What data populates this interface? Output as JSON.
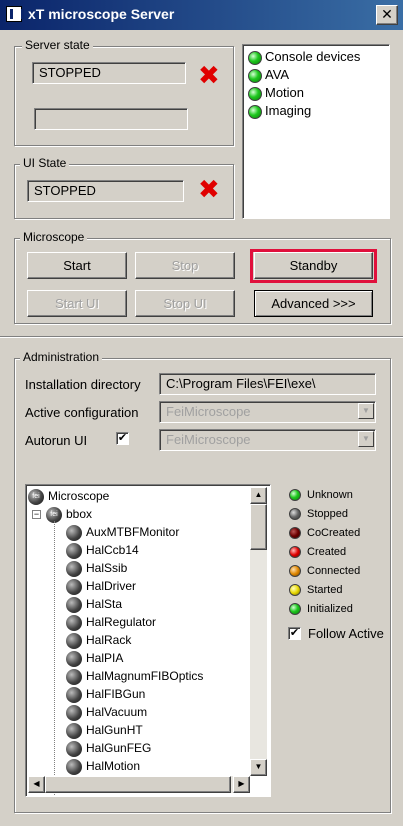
{
  "window": {
    "title": "xT microscope Server",
    "close": "✕"
  },
  "server_state": {
    "legend": "Server state",
    "value": "STOPPED",
    "secondary": "",
    "icon": "red-x-icon"
  },
  "ui_state": {
    "legend": "UI State",
    "value": "STOPPED",
    "icon": "red-x-icon"
  },
  "status_list": [
    {
      "label": "Console devices",
      "color": "green"
    },
    {
      "label": "AVA",
      "color": "green"
    },
    {
      "label": "Motion",
      "color": "green"
    },
    {
      "label": "Imaging",
      "color": "green"
    }
  ],
  "microscope": {
    "legend": "Microscope",
    "start": "Start",
    "stop": "Stop",
    "standby": "Standby",
    "start_ui": "Start UI",
    "stop_ui": "Stop UI",
    "advanced": "Advanced >>>",
    "highlight_color": "#e0103c"
  },
  "administration": {
    "legend": "Administration",
    "install_label": "Installation directory",
    "install_value": "C:\\Program Files\\FEI\\exe\\",
    "active_config_label": "Active configuration",
    "active_config_value": "FeiMicroscope",
    "autorun_label": "Autorun UI",
    "autorun_checked": "✔",
    "autorun_value": "FeiMicroscope"
  },
  "tree": {
    "root": "Microscope",
    "bbox": "bbox",
    "root_badge": "fei",
    "children": [
      "AuxMTBFMonitor",
      "HalCcb14",
      "HalSsib",
      "HalDriver",
      "HalSta",
      "HalRegulator",
      "HalRack",
      "HalPIA",
      "HalMagnumFIBOptics",
      "HalFIBGun",
      "HalVacuum",
      "HalGunHT",
      "HalGunFEG",
      "HalMotion"
    ],
    "collapse_glyph": "−"
  },
  "legend_states": [
    {
      "label": "Unknown",
      "color": "green"
    },
    {
      "label": "Stopped",
      "color": "gray"
    },
    {
      "label": "CoCreated",
      "color": "darkred"
    },
    {
      "label": "Created",
      "color": "red"
    },
    {
      "label": "Connected",
      "color": "orange"
    },
    {
      "label": "Started",
      "color": "yellow"
    },
    {
      "label": "Initialized",
      "color": "green"
    }
  ],
  "follow_active": {
    "label": "Follow Active",
    "checked": "✔"
  }
}
